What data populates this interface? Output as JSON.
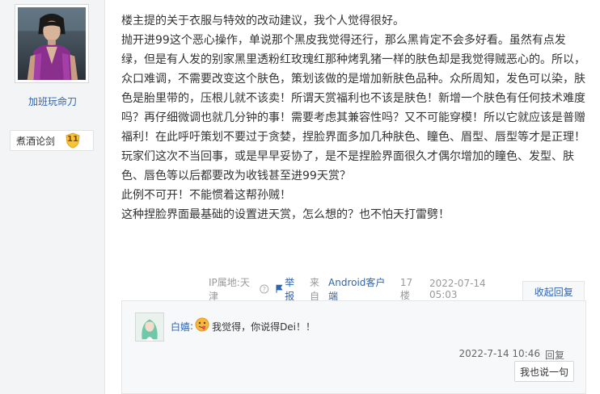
{
  "author": {
    "username": "加班玩命刀",
    "level_name": "煮酒论剑",
    "level_number": "11"
  },
  "post": {
    "paragraphs": [
      "楼主提的关于衣服与特效的改动建议，我个人觉得很好。",
      "抛开进99这个恶心操作，单说那个黑皮我觉得还行，那么黑肯定不会多好看。虽然有点发绿，但是有人发的别家黑里透粉红玫瑰红那种烤乳猪一样的肤色却是我觉得贼恶心的。所以，众口难调，不需要改变这个肤色，策划该做的是增加新肤色品种。众所周知，发色可以染，肤色是胎里带的，压根儿就不该卖！所谓天赏福利也不该是肤色！新增一个肤色有任何技术难度吗？再仔细微调也就几分钟的事！需要考虑其兼容性吗？又不可能穿模！所以它就应该是普赠福利！在此呼吁策划不要过于贪婪，捏脸界面多加几种肤色、瞳色、眉型、唇型等才是正理！",
      "玩家们这次不当回事，或是早早妥协了，是不是捏脸界面很久才偶尔增加的瞳色、发型、肤色、唇色等以后都要改为收钱甚至进99天赏？",
      "此例不可开！不能惯着这帮孙贼！",
      "这种捏脸界面最基础的设置进天赏，怎么想的？也不怕天打雷劈！"
    ]
  },
  "tail": {
    "ip": "IP属地:天津",
    "report_label": "举报",
    "from_label": "来自",
    "client_label": "Android客户端",
    "floor": "17楼",
    "time": "2022-07-14 05:03",
    "fold_label": "收起回复"
  },
  "reply": {
    "user": "白嬉",
    "colon": ":",
    "text": "我觉得，你说得Dei！！",
    "time": "2022-7-14 10:46",
    "reply_label": "回复"
  },
  "say_button": "我也说一句",
  "colors": {
    "link": "#2d64b3",
    "sidebar_bg": "#f3f4f6",
    "reply_bg": "#f7f8fa"
  }
}
